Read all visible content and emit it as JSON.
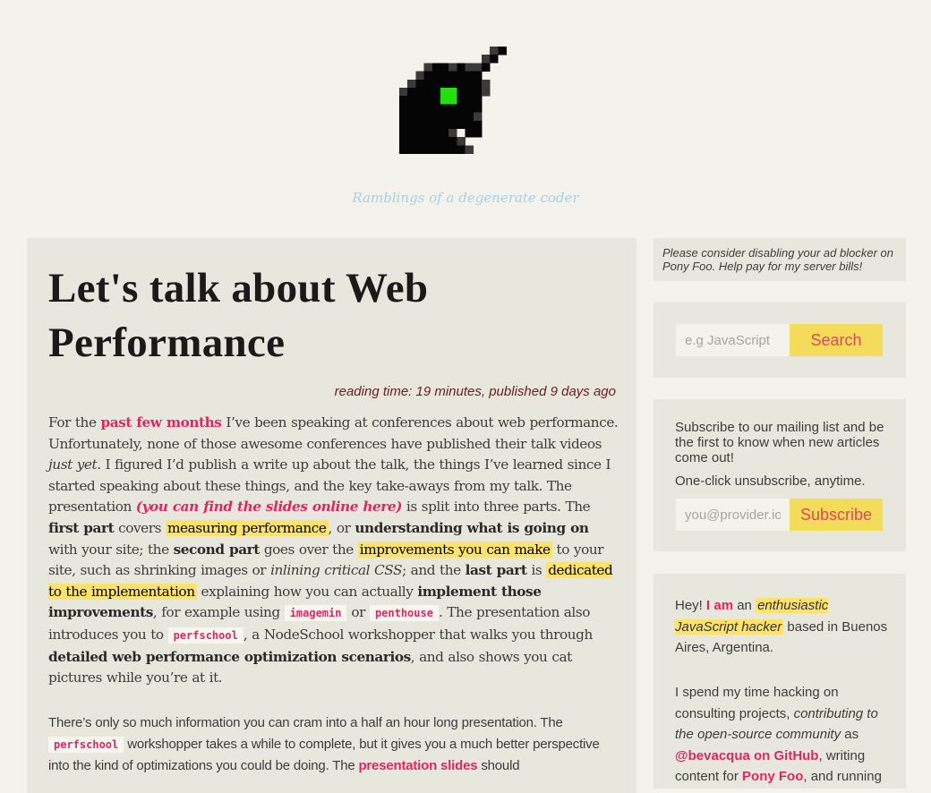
{
  "site": {
    "logo_name": "pony-foo-pixel-logo",
    "tagline": "Ramblings of a degenerate coder",
    "colors": {
      "background": "#f3f2eb",
      "panel": "#e8e7de",
      "accent_pink": "#e0265e",
      "highlight_yellow": "#fde26d",
      "button_yellow": "#f2dc5a",
      "tagline_blue": "#a9d0e6",
      "meta_red": "#6e1b1b",
      "logo_eye_green": "#22e00f"
    }
  },
  "article": {
    "title": "Let's talk about Web Performance",
    "meta": "reading time: 19 minutes, published 9 days ago",
    "p1": {
      "s1": "For the ",
      "link_past_months": "past few months",
      "s2": " I’ve been speaking at conferences about web performance. Unfortunately, none of those awesome conferences have published their talk videos ",
      "em_just_yet": "just yet",
      "s3": ". I figured I’d publish a write up about the talk, the things I’ve learned since I started speaking about these things, and the key take-aways from my talk. The presentation ",
      "link_slides": "(you can find the slides online here)",
      "s4": " is split into three parts. The ",
      "b_first_part": "first part",
      "s5": " covers ",
      "hl_measuring": "measuring performance",
      "s6": ", or ",
      "b_understanding": "understanding what is going on",
      "s7": " with your site; the ",
      "b_second_part": "second part",
      "s8": " goes over the ",
      "hl_improvements": "improvements you can make",
      "s9": " to your site, such as shrinking images or ",
      "em_inlining": "inlining critical CSS",
      "s10": "; and the ",
      "b_last_part": "last part",
      "s11": " is ",
      "hl_dedicated": "dedicated to the implementation",
      "s12": " explaining how you can actually ",
      "b_implement": "implement those improvements",
      "s13": ", for example using ",
      "code_imagemin": "imagemin",
      "s14": " or ",
      "code_penthouse": "penthouse",
      "s15": ". The presentation also introduces you to ",
      "code_perfschool": "perfschool",
      "s16": ", a NodeSchool workshopper that walks you through ",
      "b_detailed": "detailed web performance optimization scenarios",
      "s17": ", and also shows you cat pictures while you’re at it."
    },
    "p2": {
      "s1": "There’s only so much information you can cram into a half an hour long presentation. The ",
      "code_perfschool": "perfschool",
      "s2": " workshopper takes a while to complete, but it gives you a much better perspective into the kind of optimizations you could be doing. The ",
      "link_slides": "presentation slides",
      "s3": " should"
    }
  },
  "sidebar": {
    "ad_notice": "Please consider disabling your ad blocker on Pony Foo. Help pay for my server bills!",
    "search": {
      "placeholder": "e.g JavaScript",
      "value": "",
      "button_label": "Search"
    },
    "subscribe": {
      "text": "Subscribe to our mailing list and be the first to know when new articles come out!",
      "note": "One-click unsubscribe, anytime.",
      "placeholder": "you@provider.io",
      "value": "",
      "button_label": "Subscribe"
    },
    "about": {
      "hey": "Hey! ",
      "link_i_am": "I am",
      "an": " an ",
      "hl_hacker": "enthusiastic JavaScript hacker",
      "based": " based in Buenos Aires, Argentina.",
      "p2_s1": "I spend my time hacking on consulting projects, ",
      "em_contrib": "contributing to the open-source community",
      "p2_s2": " as ",
      "link_github": "@bevacqua on GitHub",
      "p2_s3": ", writing content for ",
      "link_ponyfoo": "Pony Foo",
      "p2_s4": ", and running"
    }
  }
}
